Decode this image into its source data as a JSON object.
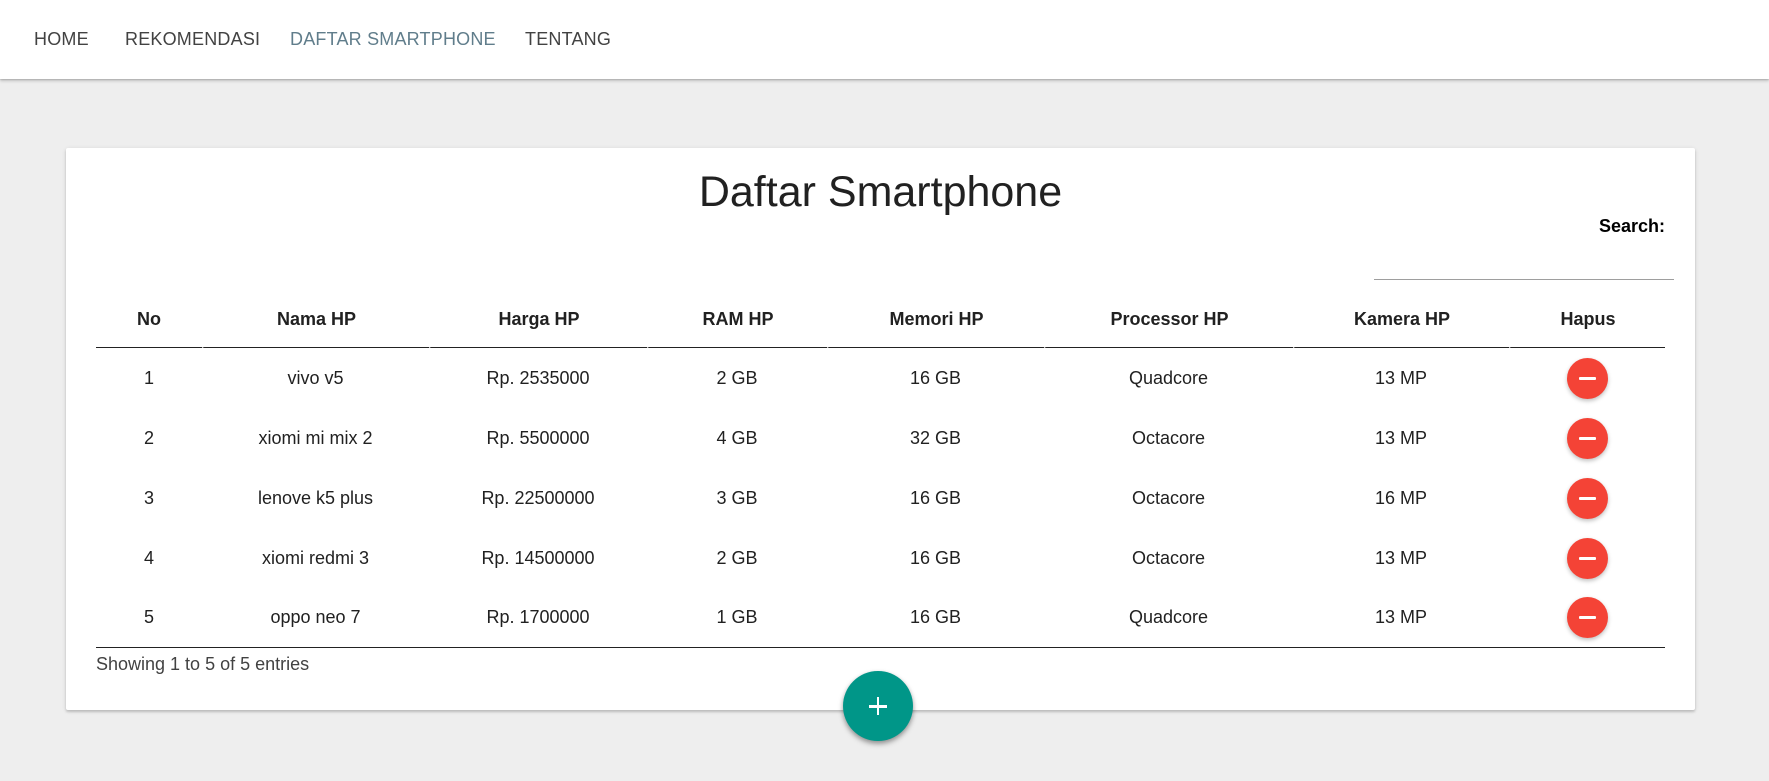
{
  "nav": {
    "items": [
      {
        "label": "HOME",
        "active": false
      },
      {
        "label": "REKOMENDASI",
        "active": false
      },
      {
        "label": "DAFTAR SMARTPHONE",
        "active": true
      },
      {
        "label": "TENTANG",
        "active": false
      }
    ]
  },
  "page": {
    "title": "Daftar Smartphone",
    "search_label": "Search:",
    "search_value": "",
    "info": "Showing 1 to 5 of 5 entries"
  },
  "table": {
    "columns": [
      "No",
      "Nama HP",
      "Harga HP",
      "RAM HP",
      "Memori HP",
      "Processor HP",
      "Kamera HP",
      "Hapus"
    ],
    "rows": [
      {
        "no": "1",
        "nama": "vivo v5",
        "harga": "Rp. 2535000",
        "ram": "2 GB",
        "memori": "16 GB",
        "processor": "Quadcore",
        "kamera": "13 MP"
      },
      {
        "no": "2",
        "nama": "xiomi mi mix 2",
        "harga": "Rp. 5500000",
        "ram": "4 GB",
        "memori": "32 GB",
        "processor": "Octacore",
        "kamera": "13 MP"
      },
      {
        "no": "3",
        "nama": "lenove k5 plus",
        "harga": "Rp. 22500000",
        "ram": "3 GB",
        "memori": "16 GB",
        "processor": "Octacore",
        "kamera": "16 MP"
      },
      {
        "no": "4",
        "nama": "xiomi redmi 3",
        "harga": "Rp. 14500000",
        "ram": "2 GB",
        "memori": "16 GB",
        "processor": "Octacore",
        "kamera": "13 MP"
      },
      {
        "no": "5",
        "nama": "oppo neo 7",
        "harga": "Rp. 1700000",
        "ram": "1 GB",
        "memori": "16 GB",
        "processor": "Quadcore",
        "kamera": "13 MP"
      }
    ]
  },
  "icons": {
    "delete": "minus-icon",
    "add": "plus-icon"
  },
  "colors": {
    "nav_active": "#607d8b",
    "delete_button": "#f44336",
    "fab": "#009688",
    "background": "#eeeeee"
  }
}
